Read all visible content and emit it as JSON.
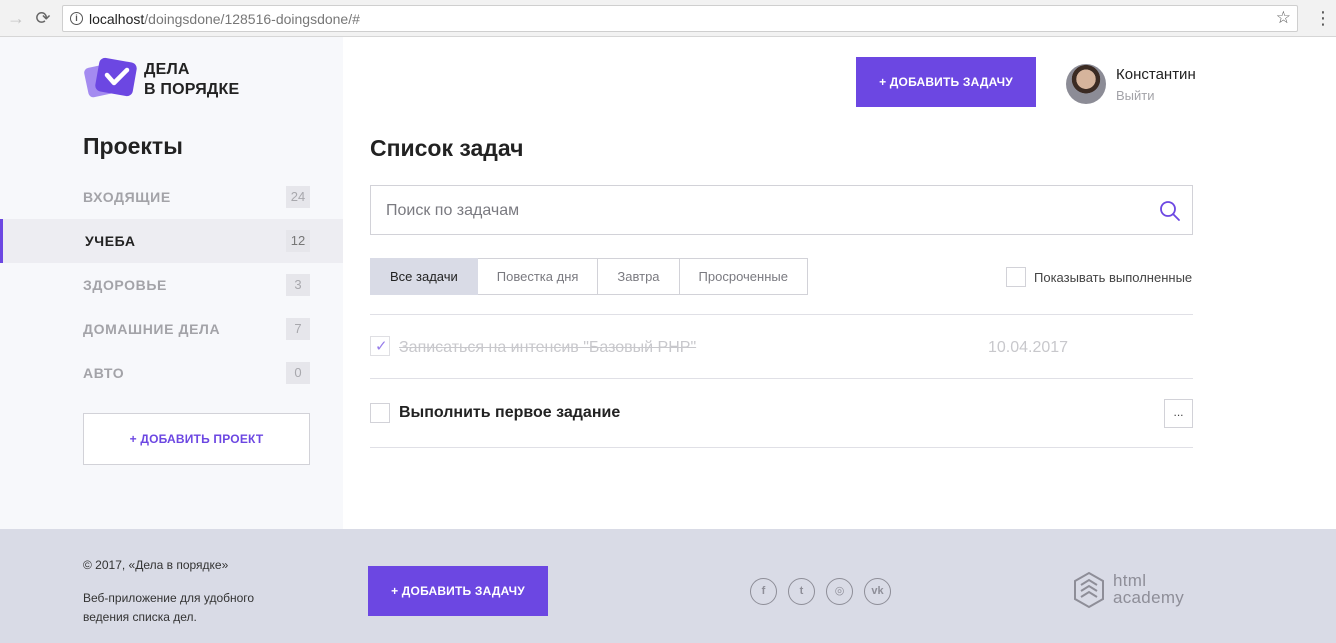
{
  "browser": {
    "url_host": "localhost",
    "url_path": "/doingsdone/128516-doingsdone/#"
  },
  "logo": {
    "line1": "ДЕЛА",
    "line2": "В ПОРЯДКЕ"
  },
  "sidebar": {
    "title": "Проекты",
    "projects": [
      {
        "label": "ВХОДЯЩИЕ",
        "count": "24",
        "active": false
      },
      {
        "label": "УЧЕБА",
        "count": "12",
        "active": true
      },
      {
        "label": "ЗДОРОВЬЕ",
        "count": "3",
        "active": false
      },
      {
        "label": "ДОМАШНИЕ ДЕЛА",
        "count": "7",
        "active": false
      },
      {
        "label": "АВТО",
        "count": "0",
        "active": false
      }
    ],
    "add_project_label": "+ ДОБАВИТЬ ПРОЕКТ"
  },
  "header": {
    "add_task_label": "+ ДОБАВИТЬ ЗАДАЧУ",
    "user_name": "Константин",
    "logout_label": "Выйти"
  },
  "main": {
    "title": "Список задач",
    "search_placeholder": "Поиск по задачам",
    "filters": [
      {
        "label": "Все задачи",
        "active": true
      },
      {
        "label": "Повестка дня",
        "active": false
      },
      {
        "label": "Завтра",
        "active": false
      },
      {
        "label": "Просроченные",
        "active": false
      }
    ],
    "show_done_label": "Показывать выполненные",
    "tasks": [
      {
        "title": "Записаться на интенсив \"Базовый PHP\"",
        "date": "10.04.2017",
        "done": true
      },
      {
        "title": "Выполнить первое задание",
        "date": "",
        "done": false,
        "menu_label": "..."
      }
    ]
  },
  "footer": {
    "copyright": "© 2017, «Дела в порядке»",
    "description": "Веб-приложение для удобного ведения списка дел.",
    "add_task_label": "+ ДОБАВИТЬ ЗАДАЧУ",
    "social": [
      {
        "icon": "facebook-icon",
        "glyph": "f"
      },
      {
        "icon": "twitter-icon",
        "glyph": "t"
      },
      {
        "icon": "instagram-icon",
        "glyph": "◎"
      },
      {
        "icon": "vk-icon",
        "glyph": "vk"
      }
    ],
    "academy_line1": "html",
    "academy_line2": "academy"
  },
  "colors": {
    "accent": "#6c47e2",
    "sidebar_bg": "#f7f8fb",
    "footer_bg": "#d9dbe6"
  }
}
